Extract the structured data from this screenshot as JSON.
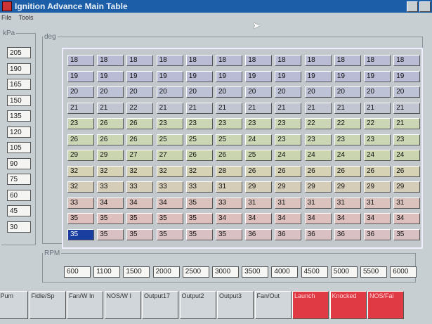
{
  "window": {
    "title": "Ignition Advance Main Table"
  },
  "menu": [
    "File",
    "Tools"
  ],
  "kpa": {
    "legend": "kPa",
    "values": [
      "205",
      "190",
      "165",
      "150",
      "135",
      "120",
      "105",
      "90",
      "75",
      "60",
      "45",
      "30"
    ]
  },
  "deg": {
    "legend": "deg",
    "rows": [
      [
        "18",
        "18",
        "18",
        "18",
        "18",
        "18",
        "18",
        "18",
        "18",
        "18",
        "18",
        "18"
      ],
      [
        "19",
        "19",
        "19",
        "19",
        "19",
        "19",
        "19",
        "19",
        "19",
        "19",
        "19",
        "19"
      ],
      [
        "20",
        "20",
        "20",
        "20",
        "20",
        "20",
        "20",
        "20",
        "20",
        "20",
        "20",
        "20"
      ],
      [
        "21",
        "21",
        "22",
        "21",
        "21",
        "21",
        "21",
        "21",
        "21",
        "21",
        "21",
        "21"
      ],
      [
        "23",
        "26",
        "26",
        "23",
        "23",
        "23",
        "23",
        "23",
        "22",
        "22",
        "22",
        "21"
      ],
      [
        "26",
        "26",
        "26",
        "25",
        "25",
        "25",
        "24",
        "23",
        "23",
        "23",
        "23",
        "23"
      ],
      [
        "29",
        "29",
        "27",
        "27",
        "26",
        "26",
        "25",
        "24",
        "24",
        "24",
        "24",
        "24"
      ],
      [
        "32",
        "32",
        "32",
        "32",
        "32",
        "28",
        "26",
        "26",
        "26",
        "26",
        "26",
        "26"
      ],
      [
        "32",
        "33",
        "33",
        "33",
        "33",
        "31",
        "29",
        "29",
        "29",
        "29",
        "29",
        "29"
      ],
      [
        "33",
        "34",
        "34",
        "34",
        "35",
        "33",
        "31",
        "31",
        "31",
        "31",
        "31",
        "31"
      ],
      [
        "35",
        "35",
        "35",
        "35",
        "35",
        "34",
        "34",
        "34",
        "34",
        "34",
        "34",
        "34"
      ],
      [
        "35",
        "35",
        "35",
        "35",
        "35",
        "35",
        "36",
        "36",
        "36",
        "36",
        "36",
        "35"
      ]
    ],
    "row_colors": [
      "#b9bcd4",
      "#b9bcd4",
      "#bdc2d6",
      "#c2c6d2",
      "#cad6b4",
      "#cad6b4",
      "#cbd6b0",
      "#d6d2b6",
      "#d6cdb8",
      "#dcc2bc",
      "#ddbfbd",
      "#d9c0c2"
    ]
  },
  "rpm": {
    "legend": "RPM",
    "values": [
      "600",
      "1100",
      "1500",
      "2000",
      "2500",
      "3000",
      "3500",
      "4000",
      "4500",
      "5000",
      "5500",
      "6000"
    ]
  },
  "tabs": [
    {
      "label": "el Pum",
      "active": false
    },
    {
      "label": "Fidle/Sp",
      "active": false
    },
    {
      "label": "Fan/W In",
      "active": false
    },
    {
      "label": "NOS/W I",
      "active": false
    },
    {
      "label": "Output17",
      "active": false
    },
    {
      "label": "Output2",
      "active": false
    },
    {
      "label": "Output3",
      "active": false
    },
    {
      "label": "Fan/Out",
      "active": false
    },
    {
      "label": "Launch",
      "active": true
    },
    {
      "label": "Knocked",
      "active": true
    },
    {
      "label": "NOS/Fai",
      "active": true
    }
  ]
}
